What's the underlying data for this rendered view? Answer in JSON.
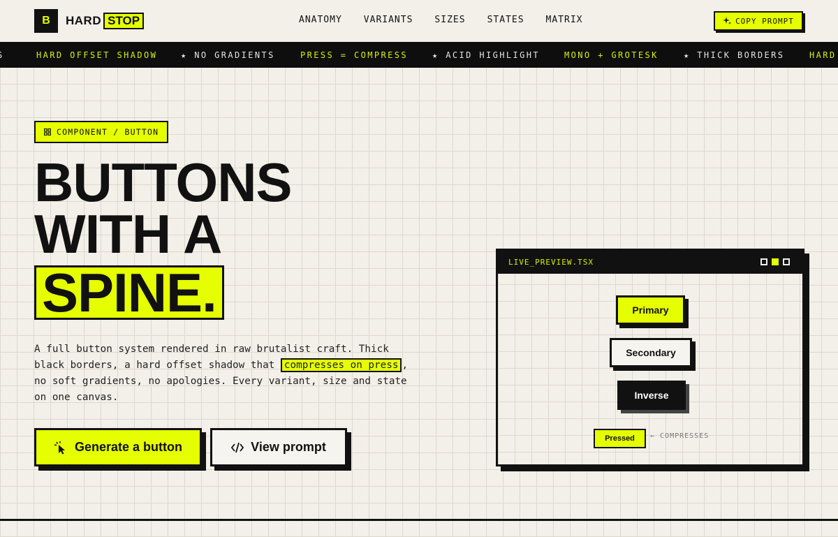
{
  "brand": {
    "mark": "B",
    "name_part1": "HARD",
    "name_part2": "STOP"
  },
  "nav": [
    {
      "label": "ANATOMY"
    },
    {
      "label": "VARIANTS"
    },
    {
      "label": "SIZES"
    },
    {
      "label": "STATES"
    },
    {
      "label": "MATRIX"
    }
  ],
  "header": {
    "copy_label": "COPY PROMPT"
  },
  "marquee": {
    "items": [
      "S",
      "HARD OFFSET SHADOW",
      "★ NO GRADIENTS",
      "PRESS = COMPRESS",
      "★ ACID HIGHLIGHT",
      "MONO + GROTESK",
      "★ THICK BORDERS",
      "HARD"
    ]
  },
  "hero": {
    "tag": "COMPONENT / BUTTON",
    "line1": "BUTTONS",
    "line2": "WITH A",
    "line3": "SPINE.",
    "para_before": "A full button system rendered in raw brutalist craft. Thick black borders, a hard offset shadow that ",
    "para_highlight": "compresses on press",
    "para_after": ", no soft gradients, no apologies. Every variant, size and state on one canvas.",
    "cta_primary": "Generate a button",
    "cta_secondary": "View prompt"
  },
  "preview": {
    "title": "LIVE_PREVIEW.TSX",
    "buttons": {
      "primary": "Primary",
      "secondary": "Secondary",
      "inverse": "Inverse",
      "pressed": "Pressed"
    },
    "pressed_note": "← COMPRESSES"
  },
  "colors": {
    "acid": "#e6ff00",
    "ink": "#111111",
    "paper": "#f3f0e9"
  },
  "icons": {
    "copy": "sparkle-icon",
    "tag": "grid-icon",
    "generate": "cursor-click-icon",
    "view": "code-icon"
  }
}
